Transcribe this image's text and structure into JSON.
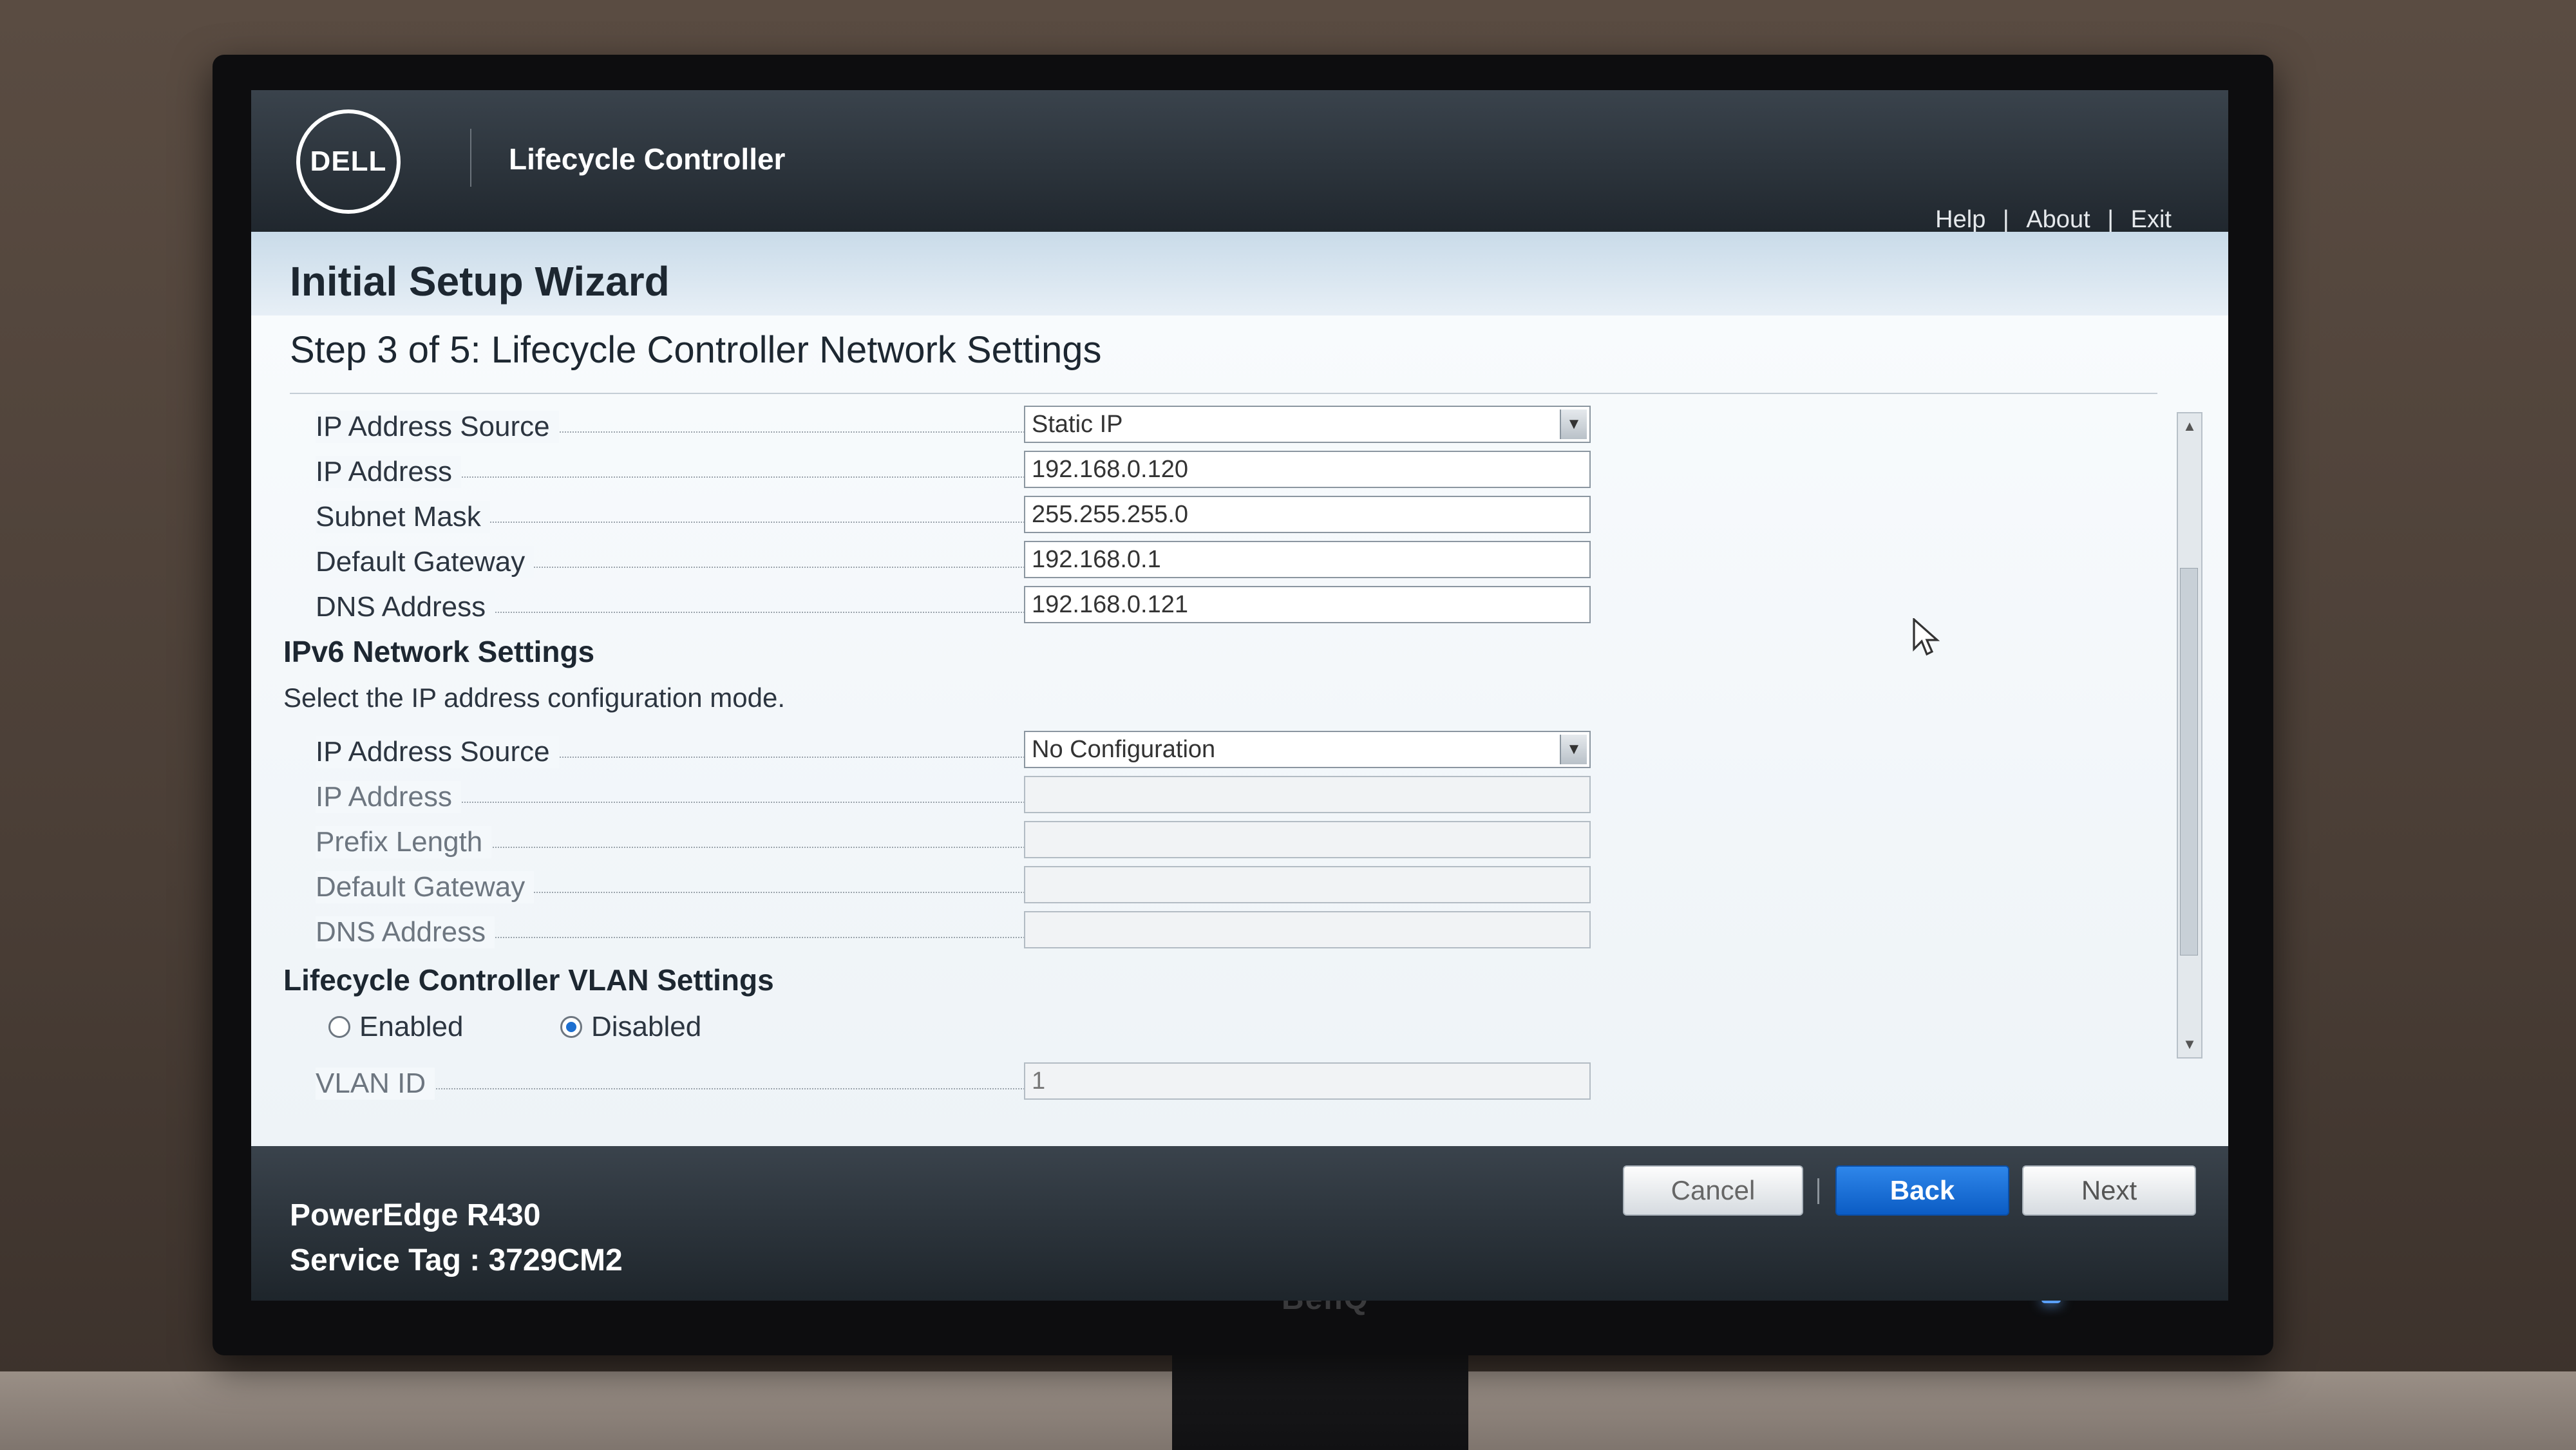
{
  "header": {
    "logo_text": "DELL",
    "app_title": "Lifecycle Controller",
    "links": [
      "Help",
      "About",
      "Exit"
    ],
    "link_separator": "|"
  },
  "wizard": {
    "title": "Initial Setup Wizard",
    "step_title": "Step 3 of 5: Lifecycle Controller Network Settings"
  },
  "ipv4": {
    "rows": [
      {
        "label": "IP Address Source",
        "value": "Static IP",
        "type": "select"
      },
      {
        "label": "IP Address",
        "value": "192.168.0.120",
        "type": "text"
      },
      {
        "label": "Subnet Mask",
        "value": "255.255.255.0",
        "type": "text"
      },
      {
        "label": "Default Gateway",
        "value": "192.168.0.1",
        "type": "text"
      },
      {
        "label": "DNS Address",
        "value": "192.168.0.121",
        "type": "text"
      }
    ]
  },
  "ipv6": {
    "heading": "IPv6 Network Settings",
    "instruction": "Select the IP address configuration mode.",
    "rows": [
      {
        "label": "IP Address Source",
        "value": "No Configuration",
        "type": "select"
      },
      {
        "label": "IP Address",
        "value": "",
        "type": "text"
      },
      {
        "label": "Prefix Length",
        "value": "",
        "type": "text"
      },
      {
        "label": "Default Gateway",
        "value": "",
        "type": "text"
      },
      {
        "label": "DNS Address",
        "value": "",
        "type": "text"
      }
    ]
  },
  "vlan": {
    "heading": "Lifecycle Controller VLAN Settings",
    "enabled_label": "Enabled",
    "disabled_label": "Disabled",
    "selected": "Disabled",
    "vlan_id_label": "VLAN ID",
    "vlan_id_value": "1"
  },
  "footer": {
    "model": "PowerEdge R430",
    "service_tag_label": "Service Tag : ",
    "service_tag_value": "3729CM2",
    "cancel_label": "Cancel",
    "back_label": "Back",
    "next_label": "Next"
  },
  "monitor": {
    "brand": "BenQ"
  },
  "colors": {
    "accent_button": "#0b5cc4",
    "header_bg": "#20272e",
    "title_bar_bg": "#c9dbe9"
  }
}
